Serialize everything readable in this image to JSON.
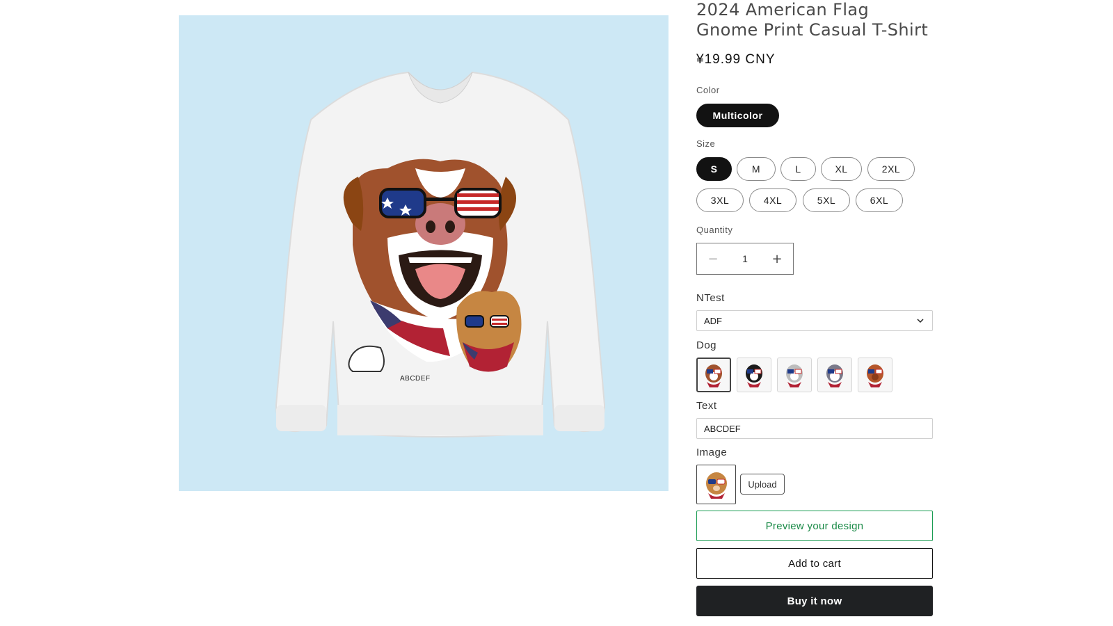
{
  "product": {
    "title": "2024 American Flag Gnome Print Casual T-Shirt",
    "price": "¥19.99 CNY",
    "print_text": "ABCDEF"
  },
  "color": {
    "label": "Color",
    "options": [
      "Multicolor"
    ],
    "selected": "Multicolor"
  },
  "size": {
    "label": "Size",
    "options": [
      "S",
      "M",
      "L",
      "XL",
      "2XL",
      "3XL",
      "4XL",
      "5XL",
      "6XL"
    ],
    "selected": "S"
  },
  "quantity": {
    "label": "Quantity",
    "value": "1",
    "minus": "−",
    "plus": "+"
  },
  "ntest": {
    "label": "NTest",
    "selected": "ADF"
  },
  "dog": {
    "label": "Dog",
    "selected_index": 0
  },
  "text_field": {
    "label": "Text",
    "value": "ABCDEF"
  },
  "image_field": {
    "label": "Image",
    "upload_label": "Upload"
  },
  "buttons": {
    "preview": "Preview your design",
    "add_to_cart": "Add to cart",
    "buy_now": "Buy it now"
  },
  "colors": {
    "background_media": "#cde8f5",
    "preview_green": "#1a8a47",
    "buy_dark": "#1f2123"
  }
}
